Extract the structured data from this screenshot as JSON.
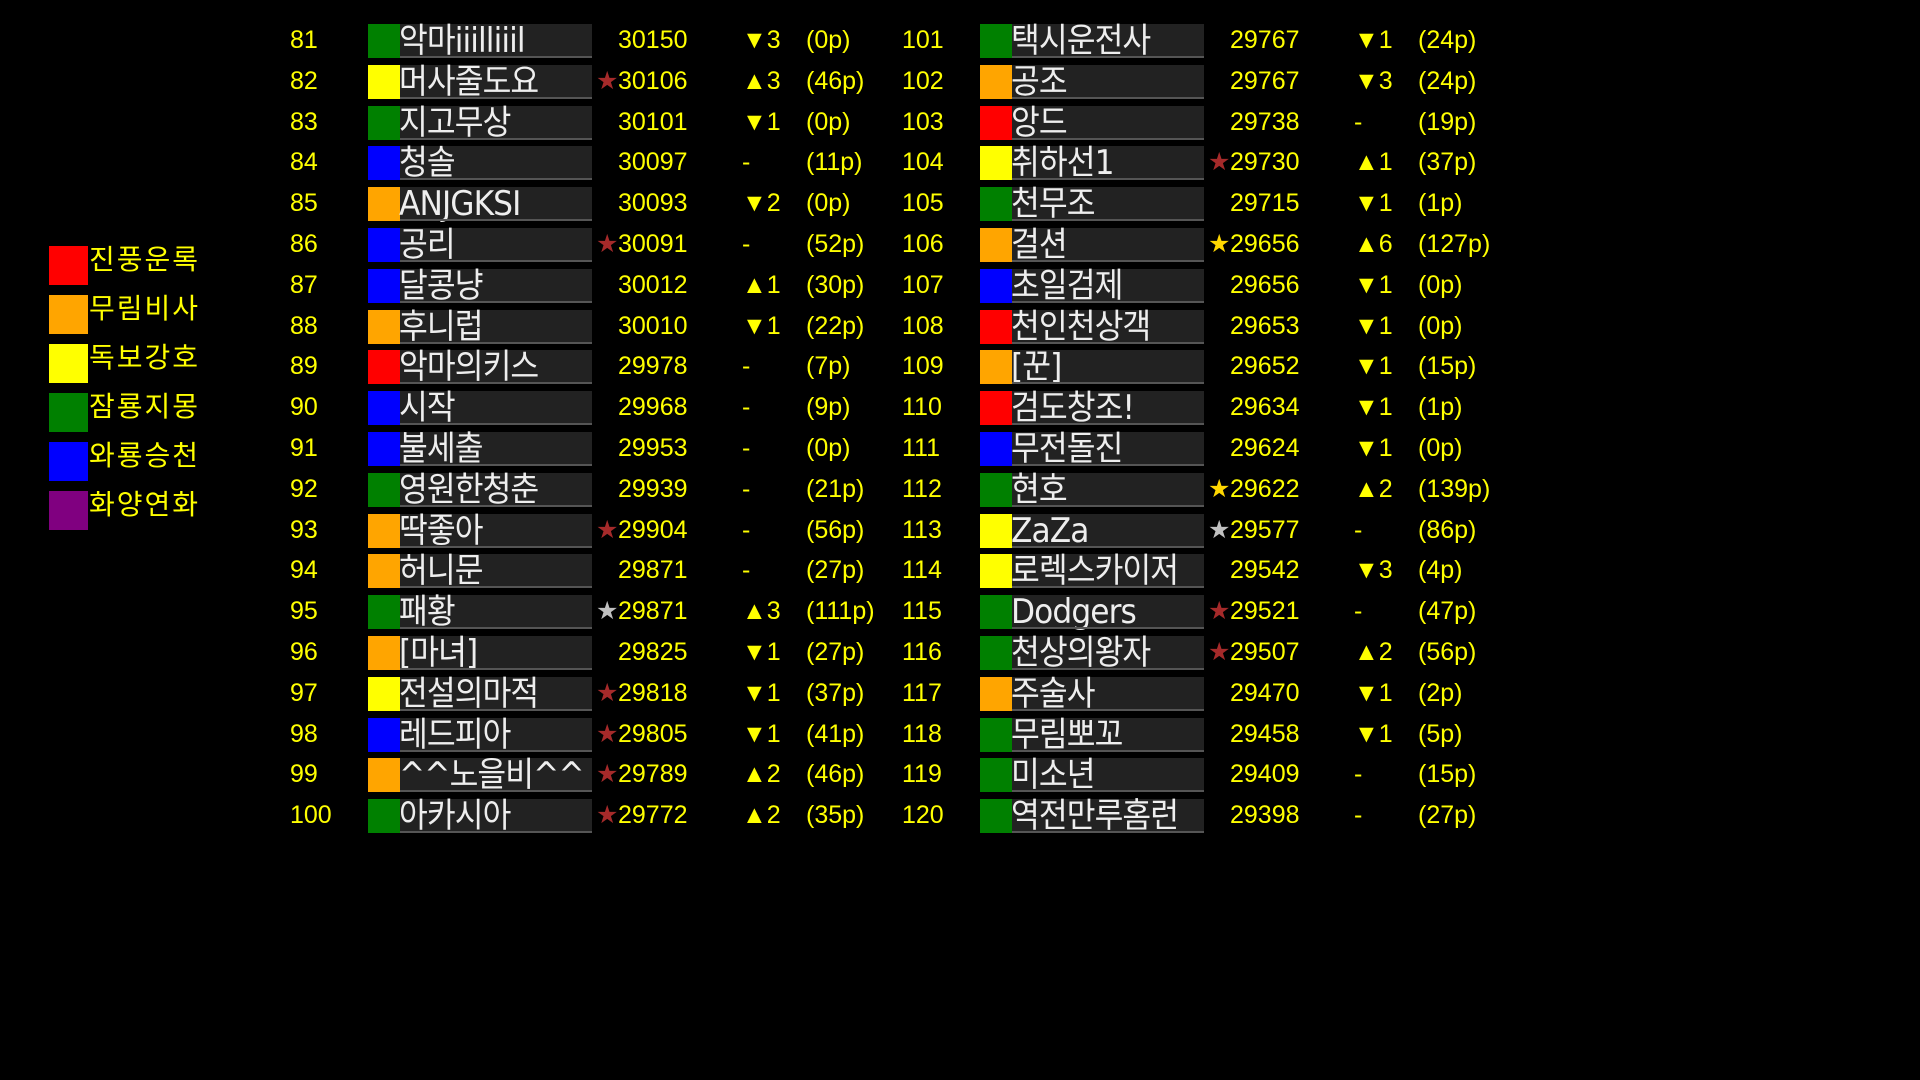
{
  "legend": [
    {
      "label": "진풍운록",
      "color": "#ff0000"
    },
    {
      "label": "무림비사",
      "color": "#ffa500"
    },
    {
      "label": "독보강호",
      "color": "#ffff00"
    },
    {
      "label": "잠룡지몽",
      "color": "#008000"
    },
    {
      "label": "와룡승천",
      "color": "#0000ff"
    },
    {
      "label": "화양연화",
      "color": "#800080"
    }
  ],
  "star_colors": {
    "red": "#a52a2a",
    "white": "#c0c0c0",
    "gold": "#ffd700"
  },
  "rows_left": [
    {
      "rank": "81",
      "team": "#008000",
      "name": "악마iiilliiil",
      "star": "",
      "score": "30150",
      "change": "▼3",
      "points": "(0p)"
    },
    {
      "rank": "82",
      "team": "#ffff00",
      "name": "머사줄도요",
      "star": "red",
      "score": "30106",
      "change": "▲3",
      "points": "(46p)"
    },
    {
      "rank": "83",
      "team": "#008000",
      "name": "지고무상",
      "star": "",
      "score": "30101",
      "change": "▼1",
      "points": "(0p)"
    },
    {
      "rank": "84",
      "team": "#0000ff",
      "name": "청솔",
      "star": "",
      "score": "30097",
      "change": "-",
      "points": "(11p)"
    },
    {
      "rank": "85",
      "team": "#ffa500",
      "name": "ANJGKSI",
      "star": "",
      "score": "30093",
      "change": "▼2",
      "points": "(0p)"
    },
    {
      "rank": "86",
      "team": "#0000ff",
      "name": "공리",
      "star": "red",
      "score": "30091",
      "change": "-",
      "points": "(52p)"
    },
    {
      "rank": "87",
      "team": "#0000ff",
      "name": "달콩냥",
      "star": "",
      "score": "30012",
      "change": "▲1",
      "points": "(30p)"
    },
    {
      "rank": "88",
      "team": "#ffa500",
      "name": "후니럽",
      "star": "",
      "score": "30010",
      "change": "▼1",
      "points": "(22p)"
    },
    {
      "rank": "89",
      "team": "#ff0000",
      "name": "악마의키스",
      "star": "",
      "score": "29978",
      "change": "-",
      "points": "(7p)"
    },
    {
      "rank": "90",
      "team": "#0000ff",
      "name": "시작",
      "star": "",
      "score": "29968",
      "change": "-",
      "points": "(9p)"
    },
    {
      "rank": "91",
      "team": "#0000ff",
      "name": "불세출",
      "star": "",
      "score": "29953",
      "change": "-",
      "points": "(0p)"
    },
    {
      "rank": "92",
      "team": "#008000",
      "name": "영원한청춘",
      "star": "",
      "score": "29939",
      "change": "-",
      "points": "(21p)"
    },
    {
      "rank": "93",
      "team": "#ffa500",
      "name": "딱좋아",
      "star": "red",
      "score": "29904",
      "change": "-",
      "points": "(56p)"
    },
    {
      "rank": "94",
      "team": "#ffa500",
      "name": "허니문",
      "star": "",
      "score": "29871",
      "change": "-",
      "points": "(27p)"
    },
    {
      "rank": "95",
      "team": "#008000",
      "name": "패황",
      "star": "white",
      "score": "29871",
      "change": "▲3",
      "points": "(111p)"
    },
    {
      "rank": "96",
      "team": "#ffa500",
      "name": "[마녀]",
      "star": "",
      "score": "29825",
      "change": "▼1",
      "points": "(27p)"
    },
    {
      "rank": "97",
      "team": "#ffff00",
      "name": "전설의마적",
      "star": "red",
      "score": "29818",
      "change": "▼1",
      "points": "(37p)"
    },
    {
      "rank": "98",
      "team": "#0000ff",
      "name": "레드피아",
      "star": "red",
      "score": "29805",
      "change": "▼1",
      "points": "(41p)"
    },
    {
      "rank": "99",
      "team": "#ffa500",
      "name": "^^노을비^^",
      "star": "red",
      "score": "29789",
      "change": "▲2",
      "points": "(46p)"
    },
    {
      "rank": "100",
      "team": "#008000",
      "name": "아카시아",
      "star": "red",
      "score": "29772",
      "change": "▲2",
      "points": "(35p)"
    }
  ],
  "rows_right": [
    {
      "rank": "101",
      "team": "#008000",
      "name": "택시운전사",
      "star": "",
      "score": "29767",
      "change": "▼1",
      "points": "(24p)"
    },
    {
      "rank": "102",
      "team": "#ffa500",
      "name": "공조",
      "star": "",
      "score": "29767",
      "change": "▼3",
      "points": "(24p)"
    },
    {
      "rank": "103",
      "team": "#ff0000",
      "name": "앙드",
      "star": "",
      "score": "29738",
      "change": "-",
      "points": "(19p)"
    },
    {
      "rank": "104",
      "team": "#ffff00",
      "name": "취하선1",
      "star": "red",
      "score": "29730",
      "change": "▲1",
      "points": "(37p)"
    },
    {
      "rank": "105",
      "team": "#008000",
      "name": "천무조",
      "star": "",
      "score": "29715",
      "change": "▼1",
      "points": "(1p)"
    },
    {
      "rank": "106",
      "team": "#ffa500",
      "name": "걸션",
      "star": "gold",
      "score": "29656",
      "change": "▲6",
      "points": "(127p)"
    },
    {
      "rank": "107",
      "team": "#0000ff",
      "name": "초일검제",
      "star": "",
      "score": "29656",
      "change": "▼1",
      "points": "(0p)"
    },
    {
      "rank": "108",
      "team": "#ff0000",
      "name": "천인천상객",
      "star": "",
      "score": "29653",
      "change": "▼1",
      "points": "(0p)"
    },
    {
      "rank": "109",
      "team": "#ffa500",
      "name": "[꾼]",
      "star": "",
      "score": "29652",
      "change": "▼1",
      "points": "(15p)"
    },
    {
      "rank": "110",
      "team": "#ff0000",
      "name": "검도창조!",
      "star": "",
      "score": "29634",
      "change": "▼1",
      "points": "(1p)"
    },
    {
      "rank": "111",
      "team": "#0000ff",
      "name": "무전돌진",
      "star": "",
      "score": "29624",
      "change": "▼1",
      "points": "(0p)"
    },
    {
      "rank": "112",
      "team": "#008000",
      "name": "현호",
      "star": "gold",
      "score": "29622",
      "change": "▲2",
      "points": "(139p)"
    },
    {
      "rank": "113",
      "team": "#ffff00",
      "name": "ZaZa",
      "star": "white",
      "score": "29577",
      "change": "-",
      "points": "(86p)"
    },
    {
      "rank": "114",
      "team": "#ffff00",
      "name": "로렉스카이저",
      "star": "",
      "score": "29542",
      "change": "▼3",
      "points": "(4p)"
    },
    {
      "rank": "115",
      "team": "#008000",
      "name": "Dodgers",
      "star": "red",
      "score": "29521",
      "change": "-",
      "points": "(47p)"
    },
    {
      "rank": "116",
      "team": "#008000",
      "name": "천상의왕자",
      "star": "red",
      "score": "29507",
      "change": "▲2",
      "points": "(56p)"
    },
    {
      "rank": "117",
      "team": "#ffa500",
      "name": "주술사",
      "star": "",
      "score": "29470",
      "change": "▼1",
      "points": "(2p)"
    },
    {
      "rank": "118",
      "team": "#008000",
      "name": "무림뽀꼬",
      "star": "",
      "score": "29458",
      "change": "▼1",
      "points": "(5p)"
    },
    {
      "rank": "119",
      "team": "#008000",
      "name": "미소년",
      "star": "",
      "score": "29409",
      "change": "-",
      "points": "(15p)"
    },
    {
      "rank": "120",
      "team": "#008000",
      "name": "역전만루홈런",
      "star": "",
      "score": "29398",
      "change": "-",
      "points": "(27p)"
    }
  ]
}
